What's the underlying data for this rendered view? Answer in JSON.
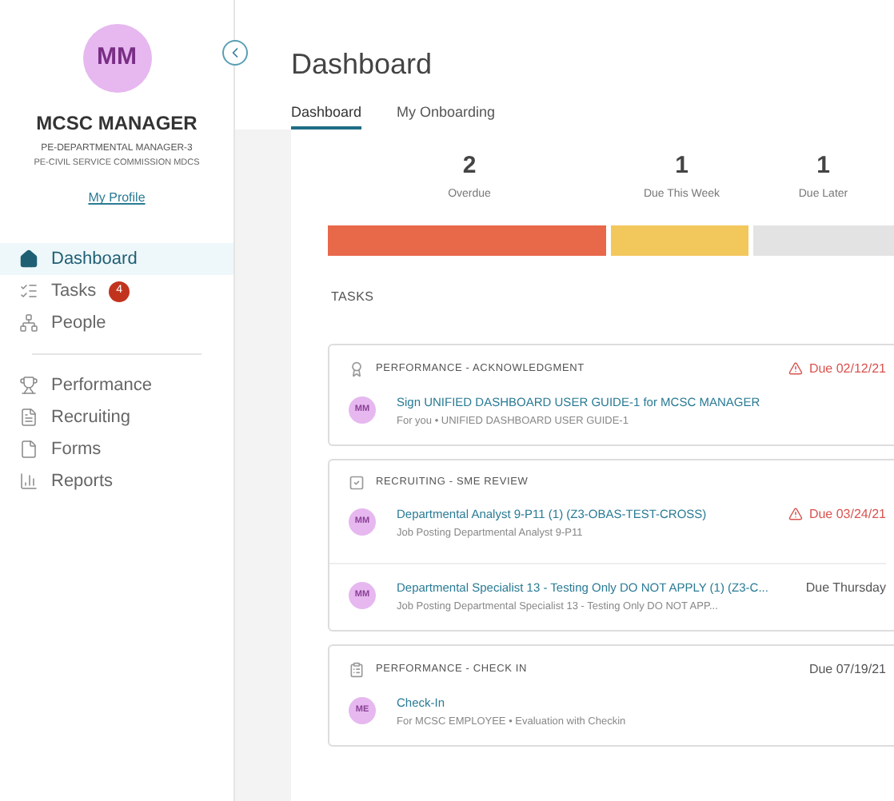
{
  "profile": {
    "initials": "MM",
    "name": "MCSC MANAGER",
    "role": "PE-DEPARTMENTAL MANAGER-3",
    "org": "PE-CIVIL SERVICE COMMISSION MDCS",
    "link": "My Profile"
  },
  "nav_primary": [
    {
      "label": "Dashboard",
      "selected": true
    },
    {
      "label": "Tasks",
      "selected": false,
      "badge": "4"
    },
    {
      "label": "People",
      "selected": false
    }
  ],
  "nav_secondary": [
    {
      "label": "Performance",
      "selected": false
    },
    {
      "label": "Recruiting",
      "selected": false
    },
    {
      "label": "Forms",
      "selected": false
    },
    {
      "label": "Reports",
      "selected": false
    }
  ],
  "title": "Dashboard",
  "tabs": [
    {
      "label": "Dashboard",
      "selected": true
    },
    {
      "label": "My Onboarding",
      "selected": false
    }
  ],
  "summary": [
    {
      "count": "2",
      "label": "Overdue",
      "color": "#e8684a"
    },
    {
      "count": "1",
      "label": "Due This Week",
      "color": "#f2c75c"
    },
    {
      "count": "1",
      "label": "Due Later",
      "color": "#e3e3e3"
    }
  ],
  "tasks_heading": "TASKS",
  "task_groups": [
    {
      "kind": "acknowledgment",
      "category": "PERFORMANCE - ACKNOWLEDGMENT",
      "due": "Due 02/12/21",
      "overdue": true,
      "items": [
        {
          "initials": "MM",
          "title": "Sign UNIFIED DASHBOARD USER GUIDE-1 for MCSC MANAGER",
          "subtitle": "For you • UNIFIED DASHBOARD USER GUIDE-1"
        }
      ]
    },
    {
      "kind": "review",
      "category": "RECRUITING - SME REVIEW",
      "items": [
        {
          "initials": "MM",
          "title": "Departmental Analyst 9-P11 (1) (Z3-OBAS-TEST-CROSS)",
          "subtitle": "Job Posting Departmental Analyst 9-P11",
          "due": "Due 03/24/21",
          "overdue": true
        },
        {
          "initials": "MM",
          "title": "Departmental Specialist 13 - Testing Only DO NOT APPLY (1) (Z3-C...",
          "subtitle": "Job Posting Departmental Specialist 13 - Testing Only DO NOT APP...",
          "due": "Due Thursday",
          "overdue": false
        }
      ]
    },
    {
      "kind": "checkin",
      "category": "PERFORMANCE - CHECK IN",
      "due": "Due 07/19/21",
      "overdue": false,
      "items": [
        {
          "initials": "ME",
          "title": "Check-In",
          "subtitle": "For MCSC EMPLOYEE • Evaluation with Checkin"
        }
      ]
    }
  ]
}
